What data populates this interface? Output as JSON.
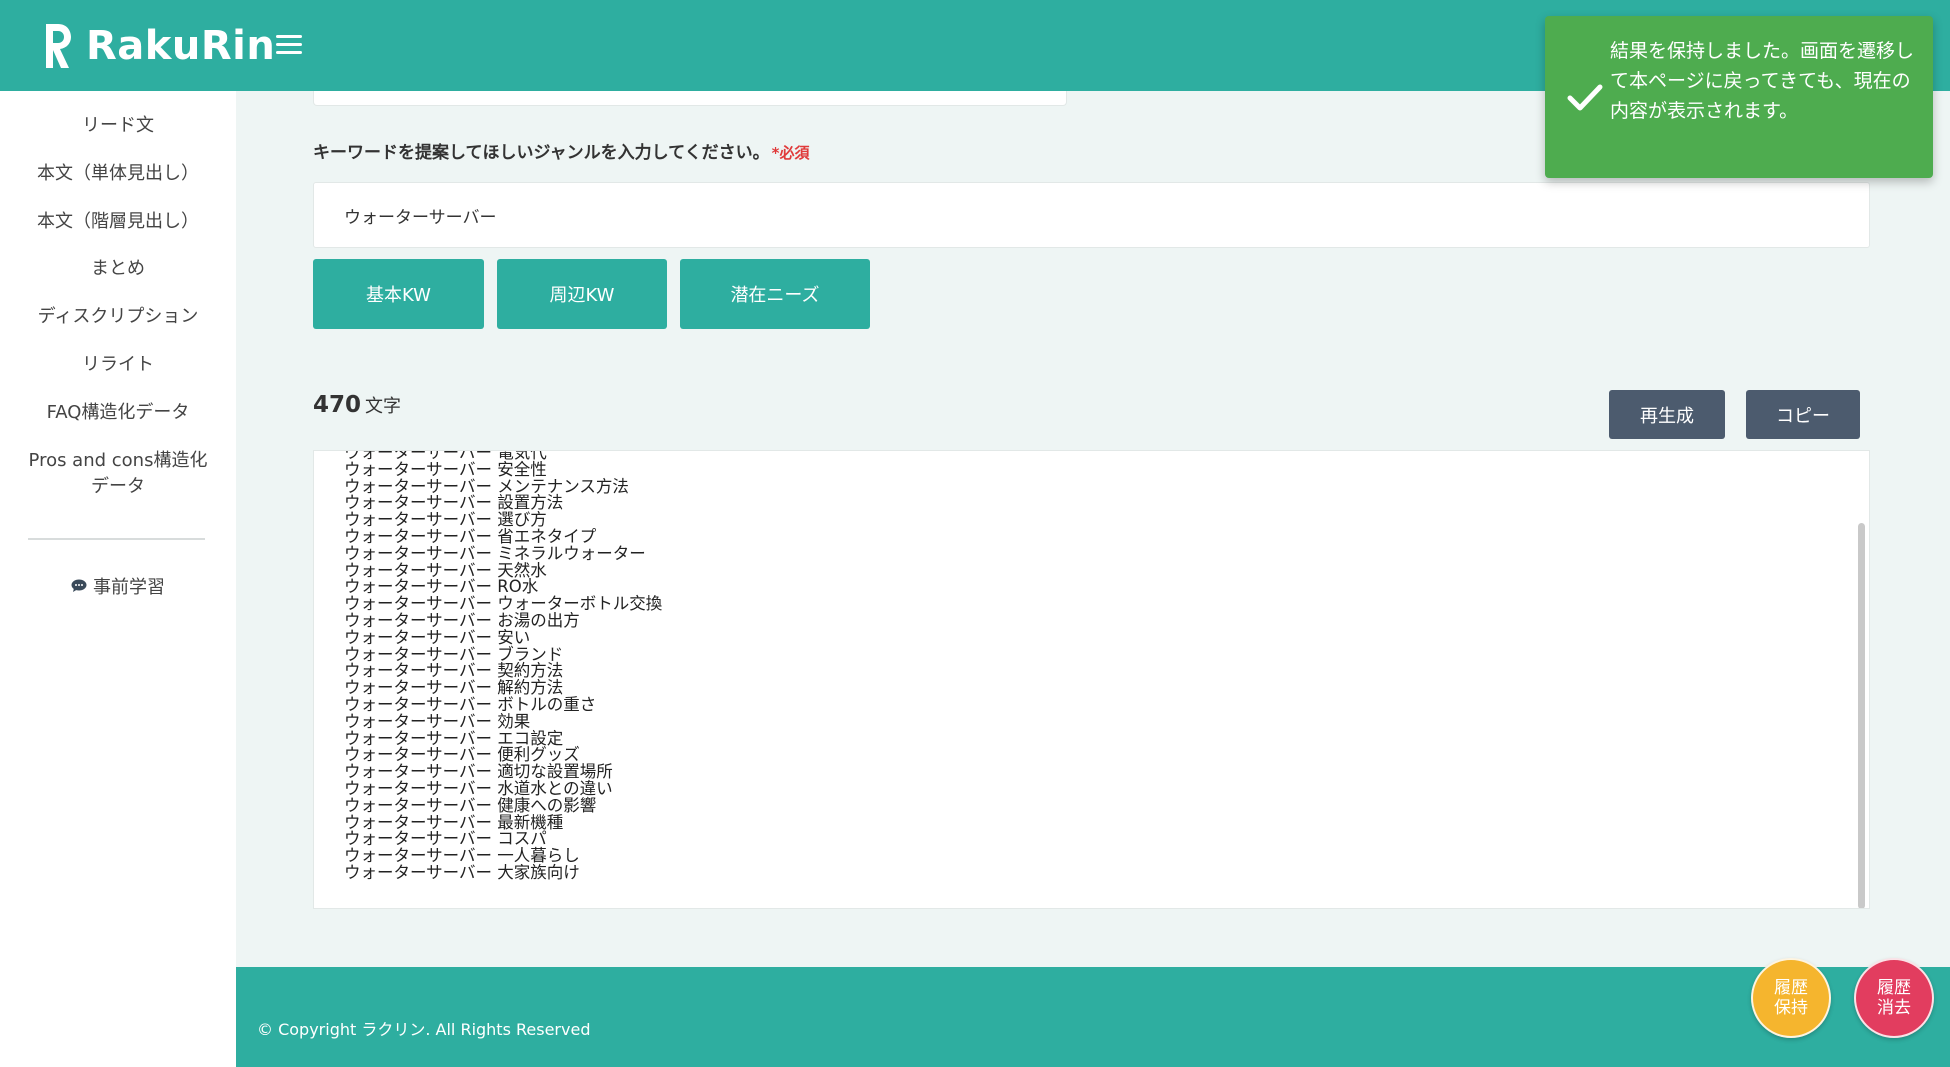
{
  "header": {
    "logo_text": "RakuRin"
  },
  "sidebar": {
    "items": [
      {
        "label": "リード文"
      },
      {
        "label": "本文（単体見出し）"
      },
      {
        "label": "本文（階層見出し）"
      },
      {
        "label": "まとめ"
      },
      {
        "label": "ディスクリプション"
      },
      {
        "label": "リライト"
      },
      {
        "label": "FAQ構造化データ"
      },
      {
        "label": "Pros and cons構造化データ"
      }
    ],
    "prelearn_label": "事前学習"
  },
  "form": {
    "genre_label": "キーワードを提案してほしいジャンルを入力してください。",
    "required_mark": "*必須",
    "genre_value": "ウォーターサーバー",
    "buttons": {
      "basic_kw": "基本KW",
      "related_kw": "周辺KW",
      "latent_needs": "潜在ニーズ"
    }
  },
  "result": {
    "char_count": "470",
    "char_unit": "文字",
    "regenerate_label": "再生成",
    "copy_label": "コピー",
    "lines": [
      "ウォーターサーバー 電気代",
      "ウォーターサーバー 安全性",
      "ウォーターサーバー メンテナンス方法",
      "ウォーターサーバー 設置方法",
      "ウォーターサーバー 選び方",
      "ウォーターサーバー 省エネタイプ",
      "ウォーターサーバー ミネラルウォーター",
      "ウォーターサーバー 天然水",
      "ウォーターサーバー RO水",
      "ウォーターサーバー ウォーターボトル交換",
      "ウォーターサーバー お湯の出方",
      "ウォーターサーバー 安い",
      "ウォーターサーバー ブランド",
      "ウォーターサーバー 契約方法",
      "ウォーターサーバー 解約方法",
      "ウォーターサーバー ボトルの重さ",
      "ウォーターサーバー 効果",
      "ウォーターサーバー エコ設定",
      "ウォーターサーバー 便利グッズ",
      "ウォーターサーバー 適切な設置場所",
      "ウォーターサーバー 水道水との違い",
      "ウォーターサーバー 健康への影響",
      "ウォーターサーバー 最新機種",
      "ウォーターサーバー コスパ",
      "ウォーターサーバー 一人暮らし",
      "ウォーターサーバー 大家族向け"
    ]
  },
  "footer": {
    "copyright": "© Copyright ラクリン. All Rights Reserved"
  },
  "floating": {
    "save_history": "履歴保持",
    "clear_history": "履歴消去",
    "save_color": "#f5b52e",
    "clear_color": "#e23d5f"
  },
  "toast": {
    "message": "結果を保持しました。画面を遷移して本ページに戻ってきても、現在の内容が表示されます。"
  },
  "colors": {
    "brand": "#2eaea0",
    "dark_button": "#4c5b6e",
    "toast_green": "#4eac4f",
    "required_red": "#e03a3a"
  }
}
